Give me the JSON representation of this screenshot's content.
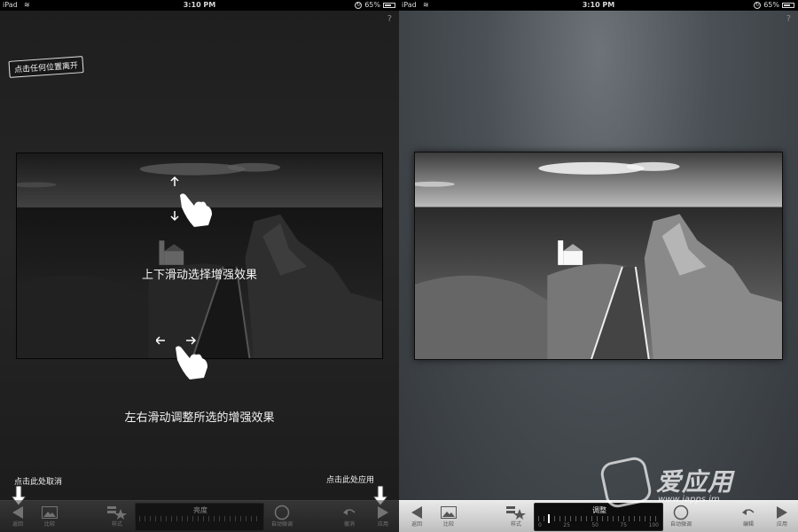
{
  "status_bar": {
    "carrier": "iPad",
    "time": "3:10 PM",
    "battery": "65%",
    "battery_level": 0.65
  },
  "help_label": "?",
  "left_screen": {
    "dismiss_tip": "点击任何位置离开",
    "vertical_hint": "上下滑动选择增强效果",
    "horizontal_hint": "左右滑动调整所选的增强效果",
    "cancel_tip": "点击此处取消",
    "apply_tip": "点击此处应用",
    "toolbar": {
      "back": "返回",
      "compare": "比较",
      "style": "样式",
      "slider_title": "亮度",
      "auto": "自动微调",
      "undo": "撤消",
      "apply": "应用"
    }
  },
  "right_screen": {
    "toolbar": {
      "back": "返回",
      "compare": "比较",
      "style": "样式",
      "slider_title": "调整",
      "slider_ticks": [
        "0",
        "25",
        "50",
        "75",
        "100"
      ],
      "slider_value": 8,
      "auto": "自动微调",
      "edit": "编辑",
      "apply": "应用"
    }
  },
  "watermark": {
    "brand": "爱应用",
    "url": "www.iapps.im"
  },
  "colors": {
    "toolbar_dark": "#2c2c2c",
    "toolbar_light": "#d8d8d8",
    "slider_bg": "#0d0d0d"
  }
}
